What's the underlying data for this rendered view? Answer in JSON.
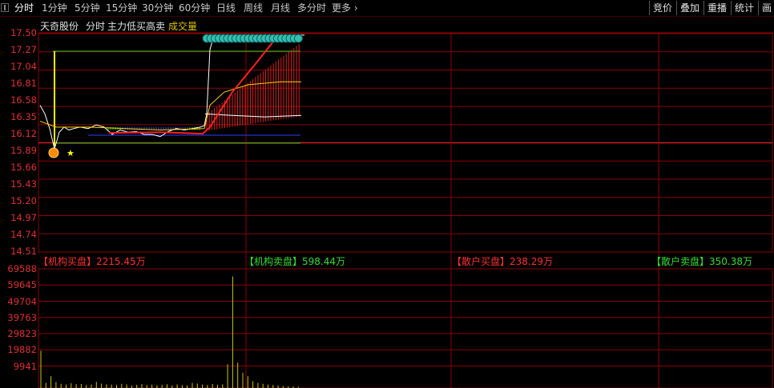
{
  "toolbar": {
    "tabs": [
      "分时",
      "1分钟",
      "5分钟",
      "15分钟",
      "30分钟",
      "60分钟",
      "日线",
      "周线",
      "月线",
      "多分时",
      "更多"
    ],
    "right_buttons": [
      "竞价",
      "叠加",
      "重播",
      "统计",
      "画"
    ]
  },
  "header": {
    "stock_name": "天奇股份",
    "mode": "分时",
    "indicator": "主力低买高卖",
    "volume_label": "成交量"
  },
  "price_axis": [
    "17.50",
    "17.27",
    "17.04",
    "16.81",
    "16.58",
    "16.35",
    "16.12",
    "15.89",
    "15.66",
    "15.43",
    "15.20",
    "14.97",
    "14.74",
    "14.51"
  ],
  "volume_axis": [
    "69588",
    "59645",
    "49704",
    "39763",
    "29823",
    "19882",
    "9941"
  ],
  "orders": {
    "inst_buy_label": "【机构买盘】",
    "inst_buy_value": "2215.45万",
    "inst_sell_label": "【机构卖盘】",
    "inst_sell_value": "598.44万",
    "retail_buy_label": "【散户买盘】",
    "retail_buy_value": "238.29万",
    "retail_sell_label": "【散户卖盘】",
    "retail_sell_value": "350.38万"
  },
  "colors": {
    "grid": "#8b0000",
    "axis_text": "#e03030",
    "price_line": "#ffffff",
    "avg_line": "#ffff00",
    "main_line": "#ff2020",
    "volume_bar": "#c8c800",
    "buy_text": "#ff3030",
    "sell_text": "#33dd33"
  },
  "chart_data": {
    "type": "line",
    "ylim": [
      14.51,
      17.5
    ],
    "prev_close": 15.89,
    "price_series": [
      {
        "t": 0,
        "v": 16.52
      },
      {
        "t": 6,
        "v": 16.4
      },
      {
        "t": 12,
        "v": 16.2
      },
      {
        "t": 18,
        "v": 15.92
      },
      {
        "t": 24,
        "v": 16.15
      },
      {
        "t": 30,
        "v": 16.22
      },
      {
        "t": 36,
        "v": 16.18
      },
      {
        "t": 42,
        "v": 16.2
      },
      {
        "t": 50,
        "v": 16.22
      },
      {
        "t": 60,
        "v": 16.2
      },
      {
        "t": 70,
        "v": 16.25
      },
      {
        "t": 80,
        "v": 16.22
      },
      {
        "t": 90,
        "v": 16.12
      },
      {
        "t": 100,
        "v": 16.18
      },
      {
        "t": 110,
        "v": 16.15
      },
      {
        "t": 120,
        "v": 16.16
      },
      {
        "t": 130,
        "v": 16.12
      },
      {
        "t": 140,
        "v": 16.12
      },
      {
        "t": 150,
        "v": 16.09
      },
      {
        "t": 160,
        "v": 16.16
      },
      {
        "t": 170,
        "v": 16.2
      },
      {
        "t": 180,
        "v": 16.18
      },
      {
        "t": 190,
        "v": 16.2
      },
      {
        "t": 200,
        "v": 16.22
      },
      {
        "t": 205,
        "v": 16.24
      },
      {
        "t": 208,
        "v": 16.4
      },
      {
        "t": 212,
        "v": 17.28
      },
      {
        "t": 216,
        "v": 17.44
      },
      {
        "t": 220,
        "v": 17.48
      },
      {
        "t": 250,
        "v": 17.48
      },
      {
        "t": 330,
        "v": 17.48
      }
    ],
    "volume": [
      22000,
      3000,
      7000,
      3500,
      2500,
      2000,
      2800,
      2200,
      2400,
      1800,
      2000,
      3600,
      2600,
      2200,
      2000,
      1800,
      2500,
      2100,
      1500,
      1900,
      2300,
      1700,
      2000,
      1600,
      1800,
      2200,
      1500,
      2100,
      1700,
      1600,
      3000,
      2600,
      2000,
      1800,
      2400,
      1900,
      2200,
      14000,
      66000,
      15000,
      9000,
      7000,
      4000,
      3000,
      2500,
      2000,
      1800,
      1500,
      1200,
      1000,
      900,
      800
    ]
  }
}
